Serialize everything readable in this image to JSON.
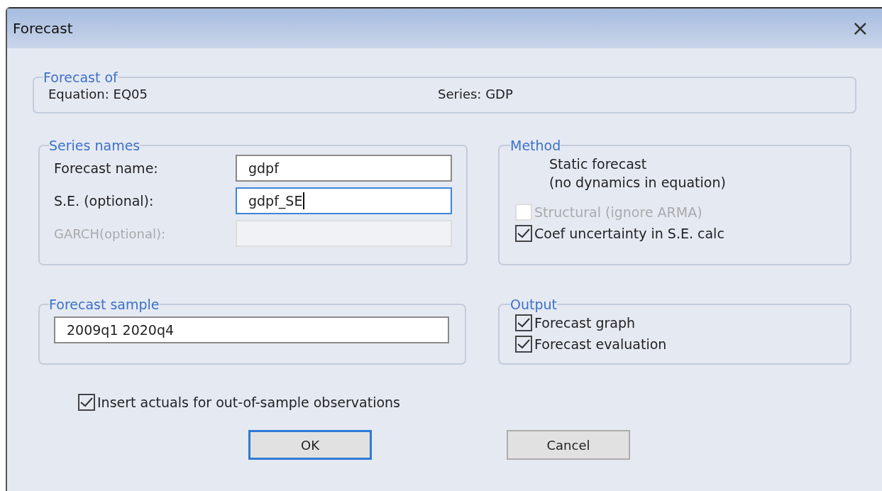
{
  "window": {
    "title": "Forecast",
    "close": "×"
  },
  "forecast_of": {
    "title": "Forecast of",
    "equation": "Equation: EQ05",
    "series": "Series: GDP"
  },
  "series_names": {
    "title": "Series names",
    "fields": [
      {
        "label": "Forecast name:",
        "value": "gdpf",
        "focused": false,
        "disabled": false
      },
      {
        "label": "S.E. (optional):",
        "value": "gdpf_SE",
        "focused": true,
        "disabled": false
      },
      {
        "label": "GARCH(optional):",
        "focused": false,
        "disabled": true
      }
    ]
  },
  "method": {
    "title": "Method",
    "description": [
      "Static forecast",
      "(no dynamics in equation)"
    ],
    "options": [
      {
        "label": "Structural (ignore ARMA)",
        "checked": false,
        "disabled": true
      },
      {
        "label": "Coef uncertainty in S.E. calc",
        "checked": true,
        "disabled": false
      }
    ]
  },
  "forecast_sample": {
    "title": "Forecast sample",
    "value": "2009q1 2020q4"
  },
  "output": {
    "title": "Output",
    "options": [
      {
        "label": "Forecast graph",
        "checked": true,
        "disabled": false
      },
      {
        "label": "Forecast evaluation",
        "checked": true,
        "disabled": false
      }
    ]
  },
  "insert_actuals": {
    "label": "Insert actuals for out-of-sample observations",
    "checked": true,
    "disabled": false
  },
  "buttons": [
    {
      "label": "OK",
      "default": true
    },
    {
      "label": "Cancel",
      "default": false
    }
  ]
}
